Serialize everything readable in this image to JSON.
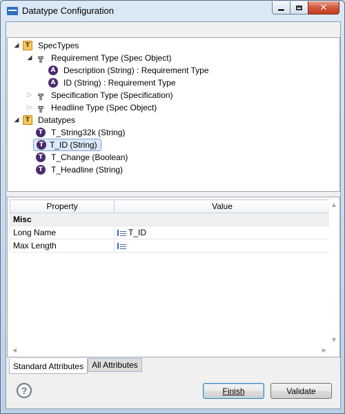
{
  "window": {
    "title": "Datatype Configuration"
  },
  "tree": {
    "nodes": [
      {
        "label": "SpecTypes",
        "icon": "folder-icon",
        "twisty": "open"
      },
      {
        "label": "Requirement Type (Spec Object)",
        "icon": "spec-type-icon",
        "twisty": "open"
      },
      {
        "label": "Description (String) : Requirement Type",
        "icon": "attribute-icon",
        "twisty": ""
      },
      {
        "label": "ID (String) : Requirement Type",
        "icon": "attribute-icon",
        "twisty": ""
      },
      {
        "label": "Specification Type (Specification)",
        "icon": "spec-type-icon",
        "twisty": "closed"
      },
      {
        "label": "Headline Type (Spec Object)",
        "icon": "spec-type-icon",
        "twisty": "closed"
      },
      {
        "label": "Datatypes",
        "icon": "folder-icon",
        "twisty": "open"
      },
      {
        "label": "T_String32k (String)",
        "icon": "datatype-icon",
        "twisty": ""
      },
      {
        "label": "T_ID (String)",
        "icon": "datatype-icon",
        "twisty": "",
        "selected": true
      },
      {
        "label": "T_Change (Boolean)",
        "icon": "datatype-icon",
        "twisty": ""
      },
      {
        "label": "T_Headline (String)",
        "icon": "datatype-icon",
        "twisty": ""
      }
    ],
    "icon_glyphs": {
      "spec_folder": "T",
      "spec_type": "╦",
      "attribute": "A",
      "datatype": "T"
    }
  },
  "properties": {
    "columns": [
      "Property",
      "Value"
    ],
    "group": "Misc",
    "rows": [
      {
        "property": "Long Name",
        "value": "T_ID"
      },
      {
        "property": "Max Length",
        "value": ""
      }
    ]
  },
  "tabs": [
    "Standard Attributes",
    "All Attributes"
  ],
  "footer": {
    "help": "?",
    "finish": "Finish",
    "validate": "Validate"
  },
  "colors": {
    "accent_selection": "#dce9fa",
    "datatype_icon": "#4b2a6e",
    "folder_icon": "#f4c65a",
    "close_button": "#c23d22"
  }
}
